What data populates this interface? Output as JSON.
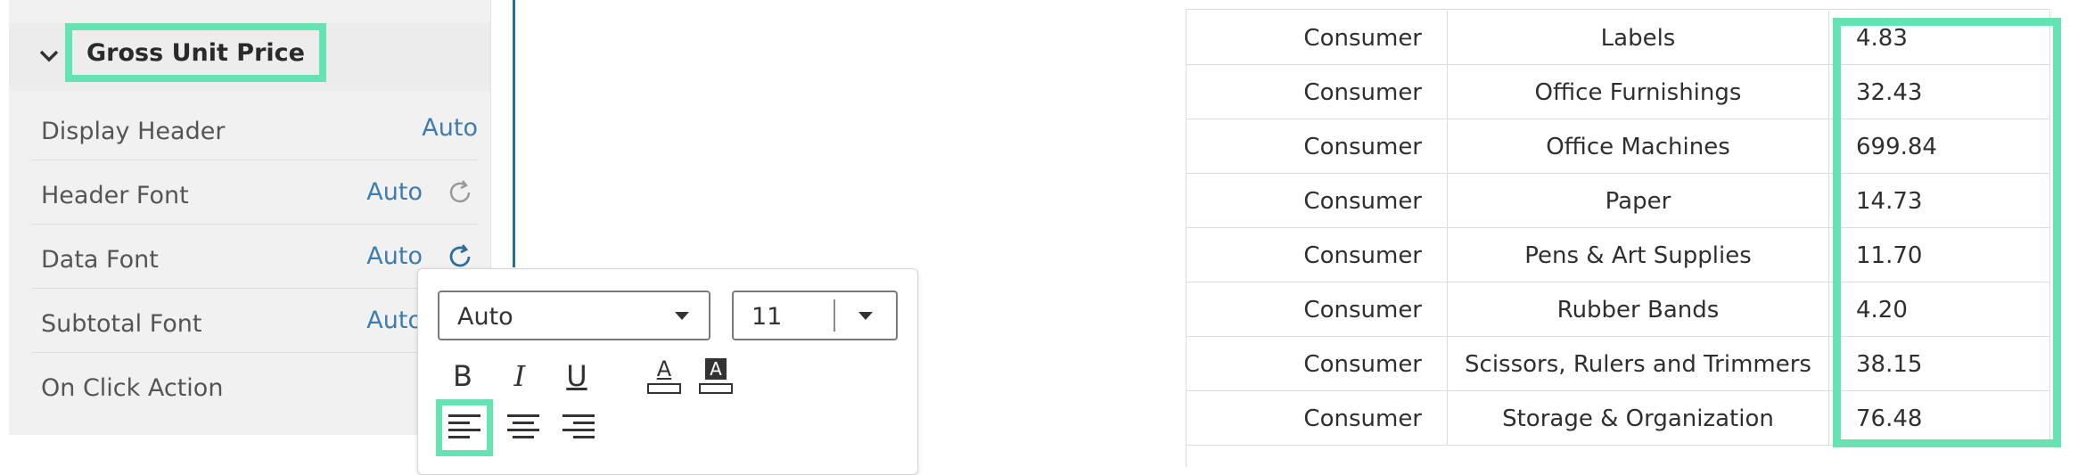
{
  "panel": {
    "section_title": "Gross Unit Price",
    "properties": [
      {
        "label": "Display Header",
        "value": "Auto"
      },
      {
        "label": "Header Font",
        "value": "Auto"
      },
      {
        "label": "Data Font",
        "value": "Auto"
      },
      {
        "label": "Subtotal Font",
        "value": "Auto"
      },
      {
        "label": "On Click Action",
        "value": ""
      }
    ]
  },
  "popup": {
    "font_family": "Auto",
    "font_size": "11",
    "bold": "B",
    "italic": "I",
    "underline": "U",
    "text_color": "A",
    "background_color": "A"
  },
  "table": {
    "rows": [
      [
        "Consumer",
        "Labels",
        "4.83"
      ],
      [
        "Consumer",
        "Office Furnishings",
        "32.43"
      ],
      [
        "Consumer",
        "Office Machines",
        "699.84"
      ],
      [
        "Consumer",
        "Paper",
        "14.73"
      ],
      [
        "Consumer",
        "Pens & Art Supplies",
        "11.70"
      ],
      [
        "Consumer",
        "Rubber Bands",
        "4.20"
      ],
      [
        "Consumer",
        "Scissors, Rulers and Trimmers",
        "38.15"
      ],
      [
        "Consumer",
        "Storage & Organization",
        "76.48"
      ]
    ]
  },
  "colors": {
    "highlight": "#66e3b3",
    "link_value": "#3c7eb0",
    "divider": "#2d6c96"
  }
}
